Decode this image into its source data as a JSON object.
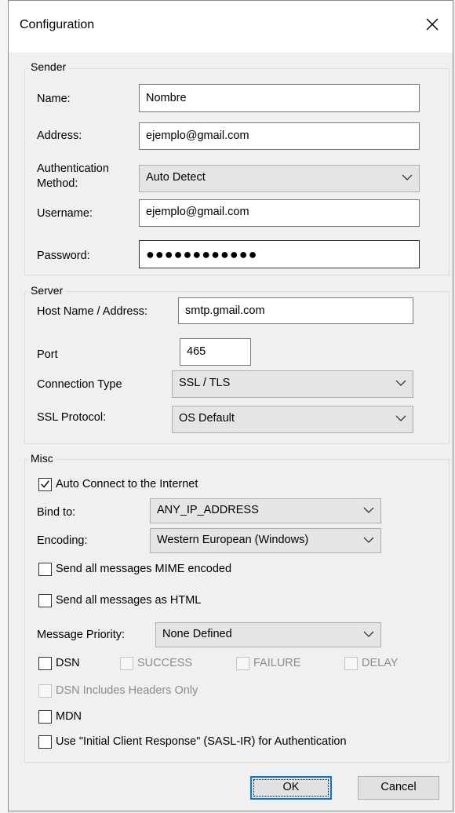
{
  "window": {
    "title": "Configuration"
  },
  "sender": {
    "legend": "Sender",
    "name_label": "Name:",
    "name_value": "Nombre",
    "address_label": "Address:",
    "address_value": "ejemplo@gmail.com",
    "auth_label_line1": "Authentication",
    "auth_label_line2": "Method:",
    "auth_value": "Auto Detect",
    "username_label": "Username:",
    "username_value": "ejemplo@gmail.com",
    "password_label": "Password:",
    "password_value": "●●●●●●●●●●●●"
  },
  "server": {
    "legend": "Server",
    "host_label": "Host Name / Address:",
    "host_value": "smtp.gmail.com",
    "port_label": "Port",
    "port_value": "465",
    "conn_label": "Connection Type",
    "conn_value": "SSL / TLS",
    "ssl_label": "SSL Protocol:",
    "ssl_value": "OS Default"
  },
  "misc": {
    "legend": "Misc",
    "auto_connect_label": "Auto Connect to the Internet",
    "auto_connect_checked": true,
    "bind_label": "Bind to:",
    "bind_value": "ANY_IP_ADDRESS",
    "encoding_label": "Encoding:",
    "encoding_value": "Western European (Windows)",
    "mime_label": "Send all messages MIME encoded",
    "html_label": "Send all messages as HTML",
    "priority_label": "Message Priority:",
    "priority_value": "None Defined",
    "dsn_label": "DSN",
    "success_label": "SUCCESS",
    "failure_label": "FAILURE",
    "delay_label": "DELAY",
    "dsn_headers_label": "DSN Includes Headers Only",
    "mdn_label": "MDN",
    "sasl_label": "Use \"Initial Client Response\" (SASL-IR) for Authentication"
  },
  "buttons": {
    "ok": "OK",
    "cancel": "Cancel"
  }
}
